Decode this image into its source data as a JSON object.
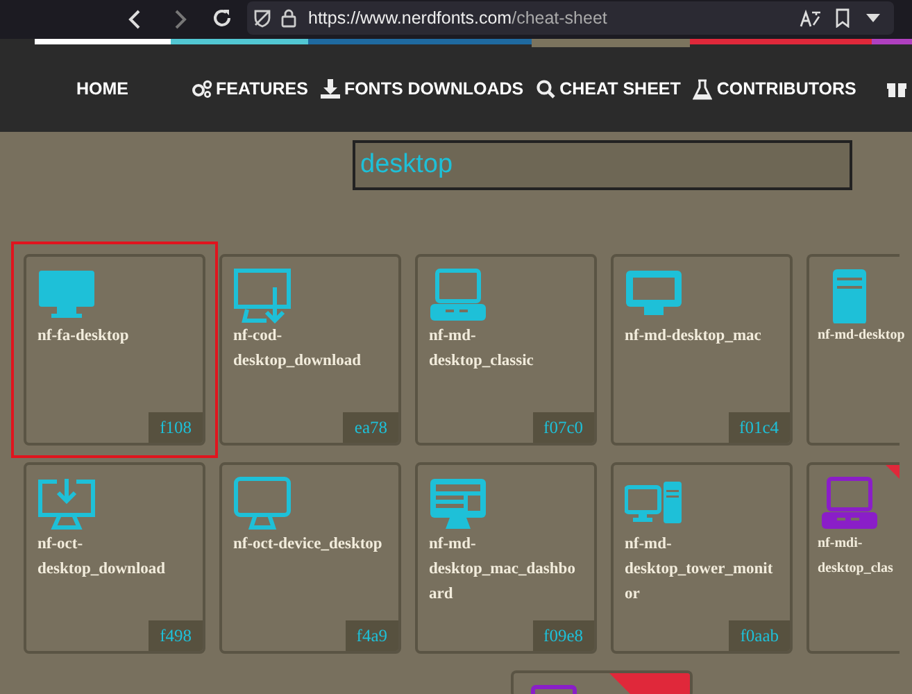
{
  "browser": {
    "url_host": "https://www.nerdfonts.com",
    "url_path": "/cheat-sheet"
  },
  "nav": [
    {
      "label": "HOME"
    },
    {
      "label": "FEATURES"
    },
    {
      "label": "FONTS DOWNLOADS"
    },
    {
      "label": "CHEAT SHEET"
    },
    {
      "label": "CONTRIBUTORS"
    }
  ],
  "search": {
    "value": "desktop"
  },
  "rows": [
    [
      {
        "name": "nf-fa-desktop",
        "code": "f108",
        "color": "#1ec0d8",
        "selected": true
      },
      {
        "name": "nf-cod-desktop_download",
        "code": "ea78",
        "color": "#1ec0d8",
        "selected": false
      },
      {
        "name": "nf-md-desktop_classic",
        "code": "f07c0",
        "color": "#1ec0d8",
        "selected": false
      },
      {
        "name": "nf-md-desktop_mac",
        "code": "f01c4",
        "color": "#1ec0d8",
        "selected": false
      },
      {
        "name": "nf-md-desktop",
        "color": "#1ec0d8",
        "selected": false
      }
    ],
    [
      {
        "name": "nf-oct-desktop_download",
        "code": "f498",
        "color": "#1ec0d8",
        "selected": false
      },
      {
        "name": "nf-oct-device_desktop",
        "code": "f4a9",
        "color": "#1ec0d8",
        "selected": false
      },
      {
        "name": "nf-md-desktop_mac_dashboard",
        "code": "f09e8",
        "color": "#1ec0d8",
        "selected": false
      },
      {
        "name": "nf-md-desktop_tower_monitor",
        "code": "f0aab",
        "color": "#1ec0d8",
        "selected": false
      },
      {
        "name": "nf-mdi-desktop_clas",
        "color": "#8a1ec8",
        "selected": false,
        "ribbon": true
      }
    ],
    [
      {
        "color": "#8a1ec8",
        "selected": false,
        "ribbon": true
      }
    ]
  ]
}
